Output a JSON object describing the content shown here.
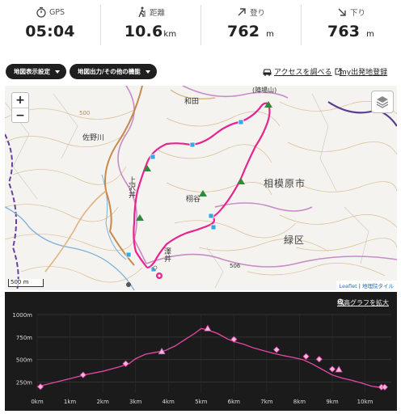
{
  "stats": [
    {
      "label": "GPS",
      "value": "05:04",
      "unit": "",
      "icon": "stopwatch-icon"
    },
    {
      "label": "距離",
      "value": "10.6",
      "unit": "km",
      "icon": "hiker-icon"
    },
    {
      "label": "登り",
      "value": "762",
      "unit": "m",
      "icon": "arrow-up-right-icon"
    },
    {
      "label": "下り",
      "value": "763",
      "unit": "m",
      "icon": "arrow-down-right-icon"
    }
  ],
  "toolbar": {
    "map_display_settings": "地図表示設定",
    "map_output": "地図出力/その他の機能",
    "access_link": "アクセスを調べる",
    "my_start_link": "my出発地登録"
  },
  "map": {
    "labels": {
      "sanoagawa": "佐野川",
      "wada": "和田",
      "kamisawai": "上沢井",
      "kashiwagi": "栩谷",
      "sagamihara": "相模原市",
      "midori": "緑区",
      "sawai": "澤井",
      "jinba": "(陣場山)",
      "elev506": "506",
      "contour500": "500"
    },
    "zoom_in": "+",
    "zoom_out": "−",
    "scale": "500 m",
    "attribution_leaflet": "Leaflet",
    "attribution_sep": " | ",
    "attribution_gsi": "地理院タイル"
  },
  "elevation": {
    "expand_link": "標高グラフを拡大",
    "y_ticks": [
      "1000m",
      "750m",
      "500m",
      "250m"
    ],
    "x_ticks": [
      "0km",
      "1km",
      "2km",
      "3km",
      "4km",
      "5km",
      "6km",
      "7km",
      "8km",
      "9km",
      "10km"
    ],
    "line_color": "#e04aa6",
    "chart_data": {
      "type": "line",
      "x": [
        0,
        0.5,
        1,
        1.5,
        2,
        2.5,
        2.8,
        3.0,
        3.3,
        3.6,
        3.9,
        4.2,
        4.5,
        4.8,
        5.0,
        5.2,
        5.5,
        5.8,
        6.0,
        6.3,
        6.6,
        6.9,
        7.2,
        7.5,
        7.8,
        8.1,
        8.4,
        8.7,
        9.0,
        9.3,
        9.6,
        9.9,
        10.2,
        10.4,
        10.6
      ],
      "y": [
        200,
        245,
        290,
        335,
        370,
        420,
        455,
        510,
        560,
        580,
        600,
        650,
        720,
        790,
        845,
        830,
        790,
        730,
        700,
        670,
        630,
        600,
        570,
        545,
        525,
        500,
        450,
        390,
        330,
        295,
        270,
        240,
        205,
        195,
        200
      ],
      "ylim": [
        130,
        1000
      ],
      "xlim": [
        0,
        10.8
      ],
      "markers": [
        {
          "x": 0.1,
          "y": 200,
          "shape": "diamond"
        },
        {
          "x": 1.4,
          "y": 330,
          "shape": "diamond"
        },
        {
          "x": 2.7,
          "y": 455,
          "shape": "diamond"
        },
        {
          "x": 3.8,
          "y": 590,
          "shape": "triangle"
        },
        {
          "x": 5.2,
          "y": 845,
          "shape": "triangle"
        },
        {
          "x": 6.0,
          "y": 725,
          "shape": "diamond"
        },
        {
          "x": 7.3,
          "y": 610,
          "shape": "diamond"
        },
        {
          "x": 8.2,
          "y": 535,
          "shape": "diamond"
        },
        {
          "x": 8.6,
          "y": 505,
          "shape": "diamond"
        },
        {
          "x": 9.0,
          "y": 395,
          "shape": "diamond"
        },
        {
          "x": 9.2,
          "y": 390,
          "shape": "triangle"
        },
        {
          "x": 10.5,
          "y": 195,
          "shape": "diamond"
        },
        {
          "x": 10.6,
          "y": 195,
          "shape": "diamond"
        }
      ]
    }
  }
}
